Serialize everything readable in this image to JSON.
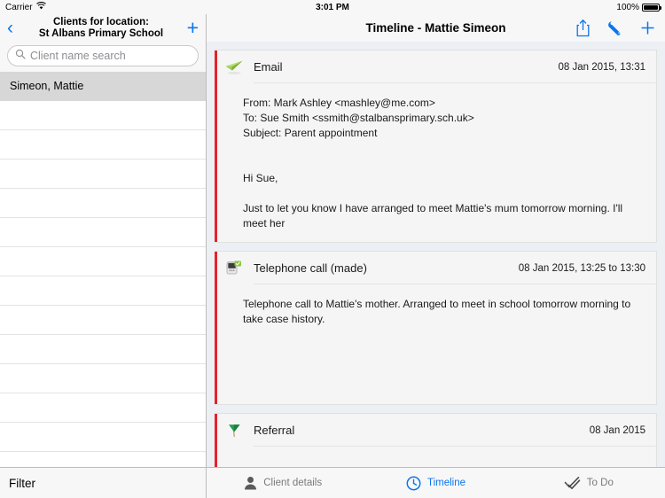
{
  "statusbar": {
    "carrier": "Carrier",
    "wifi_icon": "wifi-icon",
    "time": "3:01 PM",
    "battery_percent": "100%",
    "battery_icon": "battery-full-icon"
  },
  "sidebar": {
    "back_icon": "back-chevron-icon",
    "title_line1": "Clients for location:",
    "title_line2": "St Albans Primary School",
    "add_icon": "plus-icon",
    "search": {
      "icon": "search-icon",
      "placeholder": "Client name search",
      "value": ""
    },
    "clients": [
      {
        "name": "Simeon, Mattie",
        "selected": true
      }
    ],
    "empty_row_count": 13,
    "filter_label": "Filter"
  },
  "detail": {
    "title": "Timeline - Mattie Simeon",
    "actions": [
      {
        "name": "share-icon",
        "label": "Share"
      },
      {
        "name": "wrench-icon",
        "label": "Tools"
      },
      {
        "name": "plus-icon",
        "label": "Add"
      }
    ],
    "accent_color": "#e0242a",
    "entries": [
      {
        "icon": "email-paper-plane-icon",
        "title": "Email",
        "date": "08 Jan 2015, 13:31",
        "body": "From: Mark Ashley <mashley@me.com>\nTo: Sue Smith <ssmith@stalbansprimary.sch.uk>\nSubject: Parent appointment\n\n\nHi Sue,\n\nJust to let you know I have arranged to meet Mattie's mum tomorrow morning. I'll meet her"
      },
      {
        "icon": "telephone-call-icon",
        "title": "Telephone call (made)",
        "date": "08 Jan 2015, 13:25 to 13:30",
        "body": "Telephone call to Mattie's mother. Arranged to meet in school tomorrow morning to take case history."
      },
      {
        "icon": "referral-flag-icon",
        "title": "Referral",
        "date": "08 Jan 2015",
        "body": ""
      }
    ]
  },
  "tabbar": {
    "tabs": [
      {
        "icon": "person-icon",
        "label": "Client details",
        "active": false
      },
      {
        "icon": "clock-icon",
        "label": "Timeline",
        "active": true
      },
      {
        "icon": "checkmarks-icon",
        "label": "To Do",
        "active": false
      }
    ],
    "active_color": "#0b76ef"
  }
}
